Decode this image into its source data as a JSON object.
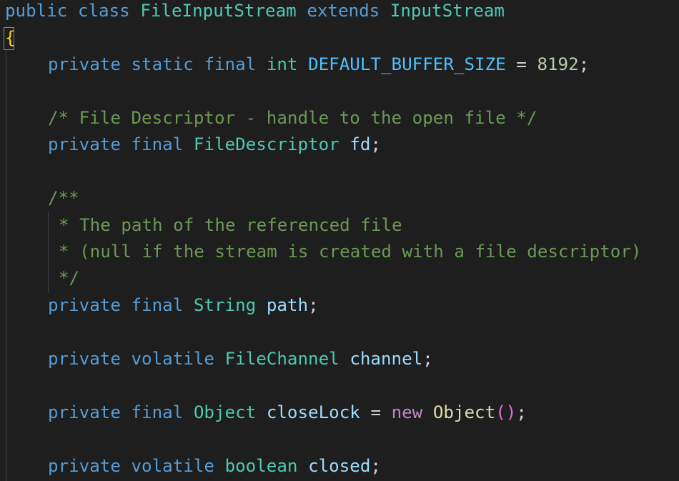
{
  "code": {
    "l1": {
      "kw_public": "public",
      "kw_class": "class",
      "class_name": "FileInputStream",
      "kw_extends": "extends",
      "super_name": "InputStream"
    },
    "l2": {
      "open_brace": "{"
    },
    "l3": {
      "kw_private": "private",
      "kw_static": "static",
      "kw_final": "final",
      "kw_int": "int",
      "const_name": "DEFAULT_BUFFER_SIZE",
      "eq": "=",
      "num": "8192",
      "semi": ";"
    },
    "l4": {
      "comment": "/* File Descriptor - handle to the open file */"
    },
    "l5": {
      "kw_private": "private",
      "kw_final": "final",
      "type": "FileDescriptor",
      "var": "fd",
      "semi": ";"
    },
    "l6": {
      "comment": "/**"
    },
    "l7": {
      "comment": "* The path of the referenced file"
    },
    "l8": {
      "comment": "* (null if the stream is created with a file descriptor)"
    },
    "l9": {
      "comment": "*/"
    },
    "l10": {
      "kw_private": "private",
      "kw_final": "final",
      "type": "String",
      "var": "path",
      "semi": ";"
    },
    "l11": {
      "kw_private": "private",
      "kw_volatile": "volatile",
      "type": "FileChannel",
      "var": "channel",
      "semi": ";"
    },
    "l12": {
      "kw_private": "private",
      "kw_final": "final",
      "type": "Object",
      "var": "closeLock",
      "eq": "=",
      "kw_new": "new",
      "ctor": "Object",
      "parens": "()",
      "semi": ";"
    },
    "l13": {
      "kw_private": "private",
      "kw_volatile": "volatile",
      "kw_boolean": "boolean",
      "var": "closed",
      "semi": ";"
    }
  }
}
